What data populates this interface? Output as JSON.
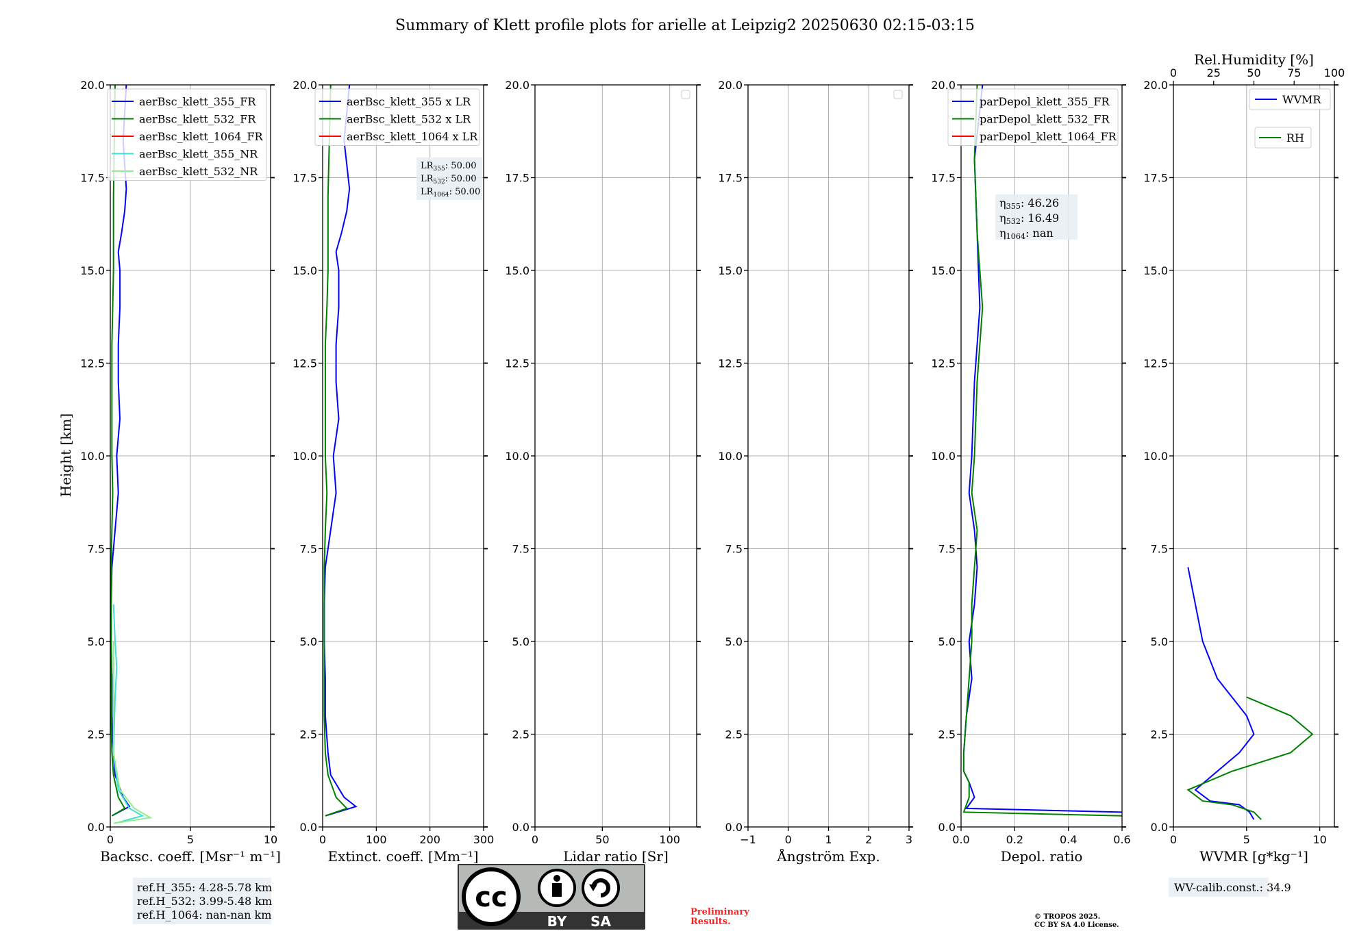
{
  "figure": {
    "title": "Summary of Klett profile plots for arielle at Leipzig2 20250630 02:15-03:15",
    "y_label": "Height [km]",
    "ref_heights": [
      "ref.H_355: 4.28-5.78 km",
      "ref.H_532: 3.99-5.48 km",
      "ref.H_1064: nan-nan km"
    ],
    "preliminary": [
      "Preliminary",
      "Results."
    ],
    "license": [
      "© TROPOS 2025.",
      "CC BY SA 4.0 License."
    ],
    "cc_badge": {
      "cc": "cc",
      "by": "BY",
      "sa": "SA"
    },
    "wv_calib": "WV-calib.const.: 34.9",
    "colors": {
      "c355": "#0000ff",
      "c532": "#008000",
      "c1064": "#ff0000",
      "nr355": "#40e0d0",
      "nr532": "#90ee90",
      "alert": "#ff2020"
    }
  },
  "chart_data": [
    {
      "type": "line",
      "xlabel": "Backsc. coeff. [Msr⁻¹ m⁻¹]",
      "ylabel": "Height [km]",
      "xlim": [
        0,
        10
      ],
      "ylim": [
        0,
        20
      ],
      "xticks": [
        "0",
        "5",
        "10"
      ],
      "yticks": [
        "0.0",
        "2.5",
        "5.0",
        "7.5",
        "10.0",
        "12.5",
        "15.0",
        "17.5",
        "20.0"
      ],
      "grid": true,
      "legend_position": "top-right",
      "legend": [
        "aerBsc_klett_355_FR",
        "aerBsc_klett_532_FR",
        "aerBsc_klett_1064_FR",
        "aerBsc_klett_355_NR",
        "aerBsc_klett_532_NR"
      ],
      "series": [
        {
          "name": "aerBsc_klett_355_FR",
          "color": "#0000ff",
          "x": [
            0.1,
            1.2,
            0.8,
            0.3,
            0.2,
            0.1,
            0.1,
            0.05,
            0.05,
            0.1,
            0.3,
            0.5,
            0.4,
            0.6,
            0.5,
            0.5,
            0.6,
            0.6,
            0.5,
            0.7,
            0.9,
            1.0,
            0.8,
            1.0
          ],
          "y": [
            0.3,
            0.55,
            0.8,
            1.4,
            2.0,
            3.0,
            4.0,
            5.0,
            6.0,
            7.0,
            8.0,
            9.0,
            10.0,
            11.0,
            12.0,
            13.0,
            14.0,
            15.0,
            15.5,
            16.0,
            16.6,
            17.2,
            18.5,
            20.0
          ]
        },
        {
          "name": "aerBsc_klett_532_FR",
          "color": "#008000",
          "x": [
            0.1,
            0.9,
            0.5,
            0.2,
            0.1,
            0.05,
            0.05,
            0.05,
            0.05,
            0.05,
            0.1,
            0.15,
            0.1,
            0.1,
            0.1,
            0.1,
            0.15,
            0.2,
            0.2,
            0.3
          ],
          "y": [
            0.3,
            0.5,
            0.8,
            1.4,
            2.0,
            3.0,
            4.0,
            5.0,
            6.0,
            7.0,
            8.0,
            9.0,
            10.0,
            11.0,
            12.0,
            13.0,
            14.0,
            15.0,
            17.0,
            20.0
          ]
        },
        {
          "name": "aerBsc_klett_355_NR",
          "color": "#40e0d0",
          "x": [
            0.3,
            2.0,
            1.2,
            0.5,
            0.2,
            0.3,
            0.4,
            0.3,
            0.2
          ],
          "y": [
            0.1,
            0.3,
            0.5,
            1.0,
            2.0,
            3.5,
            4.3,
            5.0,
            6.0
          ]
        },
        {
          "name": "aerBsc_klett_532_NR",
          "color": "#90ee90",
          "x": [
            0.2,
            2.5,
            1.5,
            0.6,
            0.2,
            0.2,
            0.2
          ],
          "y": [
            0.1,
            0.25,
            0.5,
            1.0,
            2.0,
            3.5,
            5.0
          ]
        }
      ]
    },
    {
      "type": "line",
      "xlabel": "Extinct. coeff. [Mm⁻¹]",
      "xlim": [
        0,
        300
      ],
      "ylim": [
        0,
        20
      ],
      "xticks": [
        "0",
        "100",
        "200",
        "300"
      ],
      "yticks": [
        "0.0",
        "2.5",
        "5.0",
        "7.5",
        "10.0",
        "12.5",
        "15.0",
        "17.5",
        "20.0"
      ],
      "grid": true,
      "legend_position": "top-right",
      "legend": [
        "aerBsc_klett_355 x LR",
        "aerBsc_klett_532 x LR",
        "aerBsc_klett_1064 x LR"
      ],
      "annotation": [
        "LR355: 50.00",
        "LR532: 50.00",
        "LR1064: 50.00"
      ],
      "series": [
        {
          "name": "aerBsc_klett_355 x LR",
          "color": "#0000ff",
          "x": [
            5,
            62,
            40,
            15,
            10,
            5,
            5,
            3,
            3,
            5,
            15,
            25,
            20,
            30,
            25,
            25,
            30,
            30,
            25,
            35,
            45,
            50,
            40,
            50
          ],
          "y": [
            0.3,
            0.55,
            0.8,
            1.4,
            2.0,
            3.0,
            4.0,
            5.0,
            6.0,
            7.0,
            8.0,
            9.0,
            10.0,
            11.0,
            12.0,
            13.0,
            14.0,
            15.0,
            15.5,
            16.0,
            16.6,
            17.2,
            18.5,
            20.0
          ]
        },
        {
          "name": "aerBsc_klett_532 x LR",
          "color": "#008000",
          "x": [
            5,
            45,
            25,
            10,
            5,
            3,
            3,
            3,
            3,
            3,
            5,
            8,
            5,
            5,
            5,
            5,
            8,
            10,
            10,
            15
          ],
          "y": [
            0.3,
            0.5,
            0.8,
            1.4,
            2.0,
            3.0,
            4.0,
            5.0,
            6.0,
            7.0,
            8.0,
            9.0,
            10.0,
            11.0,
            12.0,
            13.0,
            14.0,
            15.0,
            17.0,
            20.0
          ]
        }
      ]
    },
    {
      "type": "line",
      "xlabel": "Lidar ratio [Sr]",
      "xlim": [
        0,
        120
      ],
      "ylim": [
        0,
        20
      ],
      "xticks": [
        "0",
        "50",
        "100"
      ],
      "yticks": [
        "0.0",
        "2.5",
        "5.0",
        "7.5",
        "10.0",
        "12.5",
        "15.0",
        "17.5",
        "20.0"
      ],
      "grid": true,
      "legend_position": "top-right",
      "series": []
    },
    {
      "type": "line",
      "xlabel": "Ångström Exp.",
      "xlim": [
        -1,
        3
      ],
      "ylim": [
        0,
        20
      ],
      "xticks": [
        "−1",
        "0",
        "1",
        "2",
        "3"
      ],
      "yticks": [
        "0.0",
        "2.5",
        "5.0",
        "7.5",
        "10.0",
        "12.5",
        "15.0",
        "17.5",
        "20.0"
      ],
      "grid": true,
      "legend_position": "top-right",
      "series": []
    },
    {
      "type": "line",
      "xlabel": "Depol. ratio",
      "xlim": [
        0,
        0.6
      ],
      "ylim": [
        0,
        20
      ],
      "xticks": [
        "0.0",
        "0.2",
        "0.4",
        "0.6"
      ],
      "yticks": [
        "0.0",
        "2.5",
        "5.0",
        "7.5",
        "10.0",
        "12.5",
        "15.0",
        "17.5",
        "20.0"
      ],
      "grid": true,
      "legend_position": "top-right",
      "legend": [
        "parDepol_klett_355_FR",
        "parDepol_klett_532_FR",
        "parDepol_klett_1064_FR"
      ],
      "annotation": [
        "η355: 46.26",
        "η532: 16.49",
        "η1064: nan"
      ],
      "series": [
        {
          "name": "parDepol_klett_355_FR",
          "color": "#0000ff",
          "x": [
            0.6,
            0.02,
            0.05,
            0.03,
            0.01,
            0.01,
            0.02,
            0.04,
            0.03,
            0.05,
            0.06,
            0.05,
            0.03,
            0.04,
            0.05,
            0.07,
            0.06,
            0.05,
            0.08
          ],
          "y": [
            0.4,
            0.5,
            0.8,
            1.2,
            1.5,
            2.0,
            3.0,
            4.0,
            5.0,
            6.0,
            7.0,
            8.0,
            9.0,
            10.0,
            12.0,
            14.0,
            16.0,
            18.0,
            20.0
          ]
        },
        {
          "name": "parDepol_klett_532_FR",
          "color": "#008000",
          "x": [
            0.6,
            0.01,
            0.03,
            0.03,
            0.01,
            0.01,
            0.02,
            0.03,
            0.04,
            0.04,
            0.05,
            0.06,
            0.04,
            0.05,
            0.06,
            0.08,
            0.06,
            0.05,
            0.06
          ],
          "y": [
            0.3,
            0.4,
            0.8,
            1.2,
            1.5,
            2.0,
            3.0,
            4.0,
            5.0,
            6.0,
            7.0,
            8.0,
            9.0,
            10.0,
            12.0,
            14.0,
            16.0,
            18.0,
            20.0
          ]
        }
      ]
    },
    {
      "type": "line",
      "xlabel": "WVMR [g*kg⁻¹]",
      "x2label": "Rel.Humidity [%]",
      "xlim": [
        0,
        11
      ],
      "x2lim": [
        0,
        100
      ],
      "ylim": [
        0,
        20
      ],
      "xticks": [
        "0",
        "5",
        "10"
      ],
      "x2ticks": [
        "0",
        "25",
        "50",
        "75",
        "100"
      ],
      "yticks": [
        "0.0",
        "2.5",
        "5.0",
        "7.5",
        "10.0",
        "12.5",
        "15.0",
        "17.5",
        "20.0"
      ],
      "grid": true,
      "legend_position": "top-right",
      "legend": [
        "WVMR",
        "RH"
      ],
      "series": [
        {
          "name": "WVMR",
          "color": "#0000ff",
          "x": [
            5.5,
            5.2,
            4.5,
            2.5,
            1.5,
            3.0,
            4.5,
            5.5,
            5.0,
            4.0,
            3.0,
            2.0,
            1.5,
            1.0
          ],
          "y": [
            0.2,
            0.4,
            0.6,
            0.7,
            1.0,
            1.5,
            2.0,
            2.5,
            3.0,
            3.5,
            4.0,
            5.0,
            6.0,
            7.0
          ]
        },
        {
          "name": "RH",
          "color": "#008000",
          "x": [
            6.0,
            5.5,
            4.0,
            2.0,
            1.0,
            4.0,
            8.0,
            9.5,
            8.0,
            5.0
          ],
          "y": [
            0.2,
            0.4,
            0.6,
            0.7,
            1.0,
            1.5,
            2.0,
            2.5,
            3.0,
            3.5
          ]
        }
      ]
    }
  ]
}
